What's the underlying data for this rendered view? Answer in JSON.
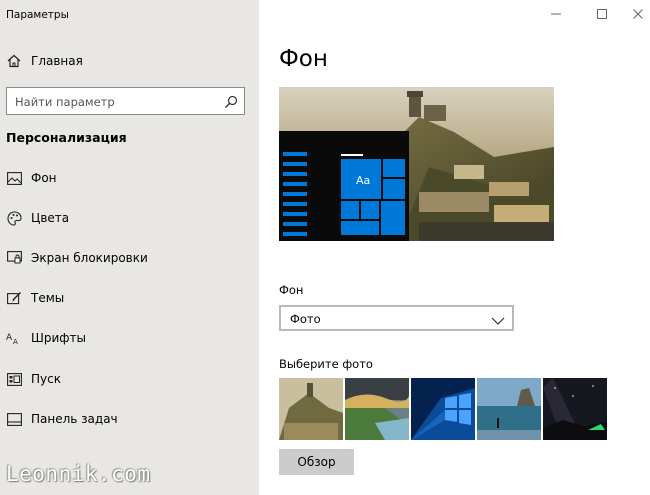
{
  "window": {
    "title": "Параметры"
  },
  "sidebar": {
    "home_label": "Главная",
    "search_placeholder": "Найти параметр",
    "section_title": "Персонализация",
    "items": [
      {
        "label": "Фон",
        "icon": "picture-icon"
      },
      {
        "label": "Цвета",
        "icon": "palette-icon"
      },
      {
        "label": "Экран блокировки",
        "icon": "lock-screen-icon"
      },
      {
        "label": "Темы",
        "icon": "themes-icon"
      },
      {
        "label": "Шрифты",
        "icon": "fonts-icon"
      },
      {
        "label": "Пуск",
        "icon": "start-icon"
      },
      {
        "label": "Панель задач",
        "icon": "taskbar-icon"
      }
    ]
  },
  "main": {
    "title": "Фон",
    "preview_tile_text": "Aa",
    "background_label": "Фон",
    "background_value": "Фото",
    "choose_photo_label": "Выберите фото",
    "browse_label": "Обзор"
  },
  "watermark": "Leonnik.com",
  "colors": {
    "sidebar_bg": "#e9e7e3",
    "accent_blue": "#0078d7",
    "button_gray": "#cccccc"
  }
}
